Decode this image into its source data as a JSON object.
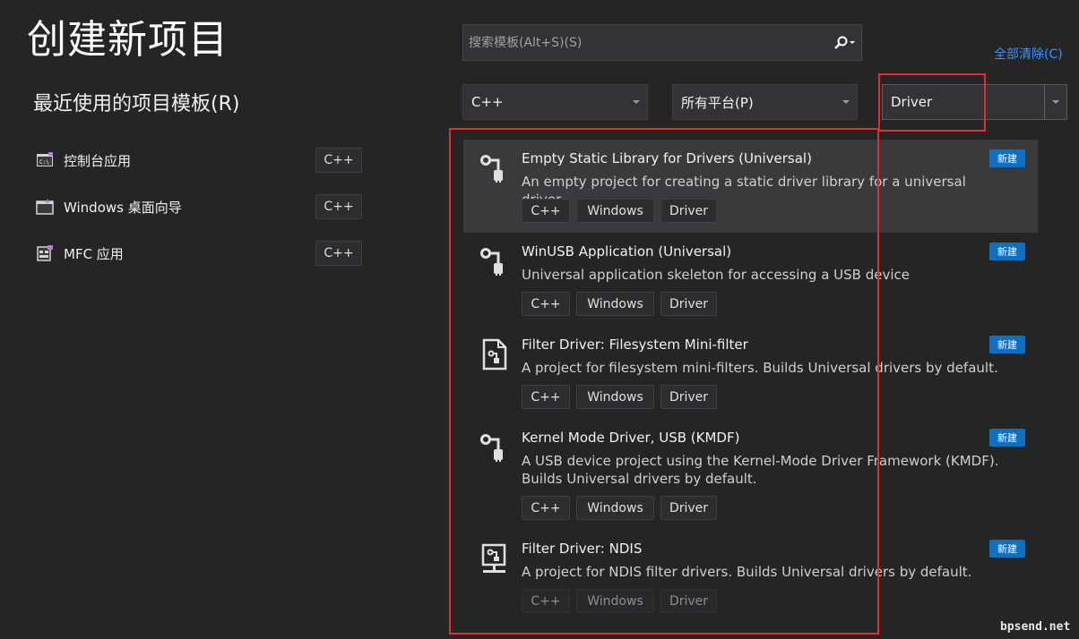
{
  "page": {
    "title": "创建新项目"
  },
  "recent": {
    "title": "最近使用的项目模板(R)",
    "items": [
      {
        "label": "控制台应用",
        "tag": "C++",
        "icon": "console-app-icon"
      },
      {
        "label": "Windows 桌面向导",
        "tag": "C++",
        "icon": "desktop-wizard-icon"
      },
      {
        "label": "MFC 应用",
        "tag": "C++",
        "icon": "mfc-app-icon"
      }
    ]
  },
  "search": {
    "placeholder": "搜索模板(Alt+S)(S)",
    "icon": "search-icon"
  },
  "filters": {
    "clear_label": "全部清除(C)",
    "language": "C++",
    "platform": "所有平台(P)",
    "project_type": "Driver"
  },
  "templates": [
    {
      "name": "Empty Static Library for Drivers (Universal)",
      "desc": "An empty project for creating a static driver library for a universal driver",
      "badge": "新建",
      "tags": [
        "C++",
        "Windows",
        "Driver"
      ],
      "icon": "driver-plug-icon"
    },
    {
      "name": "WinUSB Application (Universal)",
      "desc": "Universal application skeleton for accessing a USB device",
      "badge": "新建",
      "tags": [
        "C++",
        "Windows",
        "Driver"
      ],
      "icon": "driver-plug-icon"
    },
    {
      "name": "Filter Driver: Filesystem Mini-filter",
      "desc": "A project for filesystem mini-filters. Builds Universal drivers by default.",
      "badge": "新建",
      "tags": [
        "C++",
        "Windows",
        "Driver"
      ],
      "icon": "file-filter-icon"
    },
    {
      "name": "Kernel Mode Driver, USB (KMDF)",
      "desc": "A USB device project using the Kernel-Mode Driver Framework (KMDF). Builds Universal drivers by default.",
      "badge": "新建",
      "tags": [
        "C++",
        "Windows",
        "Driver"
      ],
      "icon": "driver-plug-icon"
    },
    {
      "name": "Filter Driver: NDIS",
      "desc": "A project for NDIS filter drivers. Builds Universal drivers by default.",
      "badge": "新建",
      "tags": [
        "C++",
        "Windows",
        "Driver"
      ],
      "icon": "network-filter-icon"
    }
  ],
  "watermark": "bpsend.net"
}
